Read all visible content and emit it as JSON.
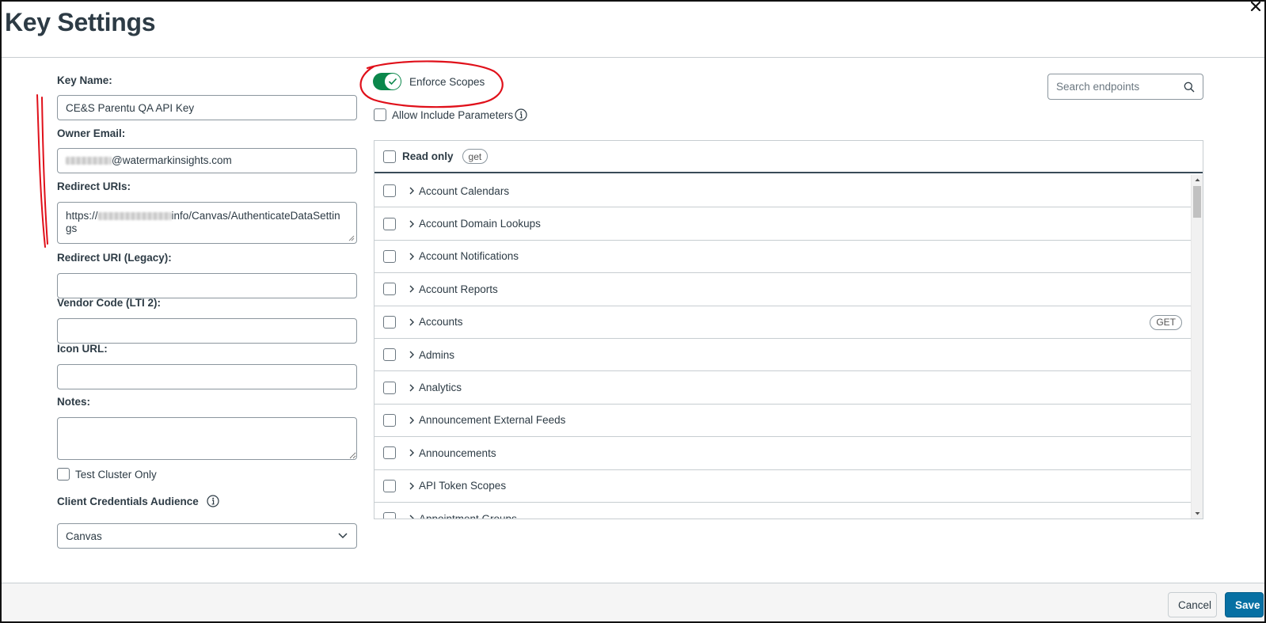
{
  "modal": {
    "title": "Key Settings"
  },
  "form": {
    "key_name": {
      "label": "Key Name:",
      "value": "CE&S Parentu QA API Key"
    },
    "owner_email": {
      "label": "Owner Email:",
      "value_visible": "@watermarkinsights.com"
    },
    "redirect_uris": {
      "label": "Redirect URIs:",
      "value_prefix": "https://",
      "value_mid": "info/Canvas/AuthenticateDataSettin",
      "value_end": "gs"
    },
    "redirect_uri_legacy": {
      "label": "Redirect URI (Legacy):",
      "value": ""
    },
    "vendor_code": {
      "label": "Vendor Code (LTI 2):",
      "value": ""
    },
    "icon_url": {
      "label": "Icon URL:",
      "value": ""
    },
    "notes": {
      "label": "Notes:",
      "value": ""
    },
    "test_cluster_only": {
      "label": "Test Cluster Only",
      "checked": false
    },
    "client_credentials_audience": {
      "label": "Client Credentials Audience",
      "selected": "Canvas"
    }
  },
  "scopes": {
    "enforce_scopes": {
      "label": "Enforce Scopes",
      "on": true
    },
    "allow_include_parameters": {
      "label": "Allow Include Parameters",
      "checked": false
    },
    "search": {
      "placeholder": "Search endpoints"
    },
    "read_only": {
      "label": "Read only",
      "badge": "get"
    },
    "groups": [
      {
        "name": "Account Calendars",
        "badge": ""
      },
      {
        "name": "Account Domain Lookups",
        "badge": ""
      },
      {
        "name": "Account Notifications",
        "badge": ""
      },
      {
        "name": "Account Reports",
        "badge": ""
      },
      {
        "name": "Accounts",
        "badge": "GET"
      },
      {
        "name": "Admins",
        "badge": ""
      },
      {
        "name": "Analytics",
        "badge": ""
      },
      {
        "name": "Announcement External Feeds",
        "badge": ""
      },
      {
        "name": "Announcements",
        "badge": ""
      },
      {
        "name": "API Token Scopes",
        "badge": ""
      },
      {
        "name": "Appointment Groups",
        "badge": ""
      }
    ]
  },
  "footer": {
    "cancel_label": "Cancel",
    "save_label": "Save"
  },
  "colors": {
    "toggle_on": "#0b874b",
    "primary_button": "#0770a3",
    "annotation": "#e0101a"
  }
}
